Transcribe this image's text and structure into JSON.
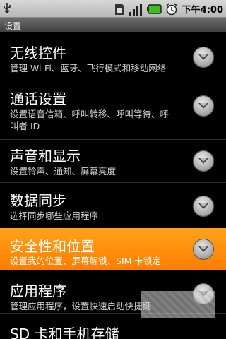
{
  "status_bar": {
    "time": "下午4:00",
    "icons": [
      "usb-icon",
      "sim-icon",
      "signal-icon",
      "battery-icon",
      "alarm-icon"
    ]
  },
  "title_bar": {
    "title": "设置"
  },
  "colors": {
    "selected_bg": "#ff8c00",
    "background": "#000000"
  },
  "settings": {
    "items": [
      {
        "title": "无线控件",
        "subtitle": "管理 Wi-Fi、蓝牙、飞行模式和移动网络"
      },
      {
        "title": "通话设置",
        "subtitle": "设置语音信箱、呼叫转移、呼叫等待、呼叫者 ID"
      },
      {
        "title": "声音和显示",
        "subtitle": "设置铃声、通知、屏幕亮度"
      },
      {
        "title": "数据同步",
        "subtitle": "选择同步哪些应用程序"
      },
      {
        "title": "安全性和位置",
        "subtitle": "设置我的位置、屏幕解锁、SIM 卡锁定",
        "selected": true
      },
      {
        "title": "应用程序",
        "subtitle": "管理应用程序，设置快速启动快捷键"
      },
      {
        "title": "SD 卡和手机存储"
      }
    ]
  }
}
